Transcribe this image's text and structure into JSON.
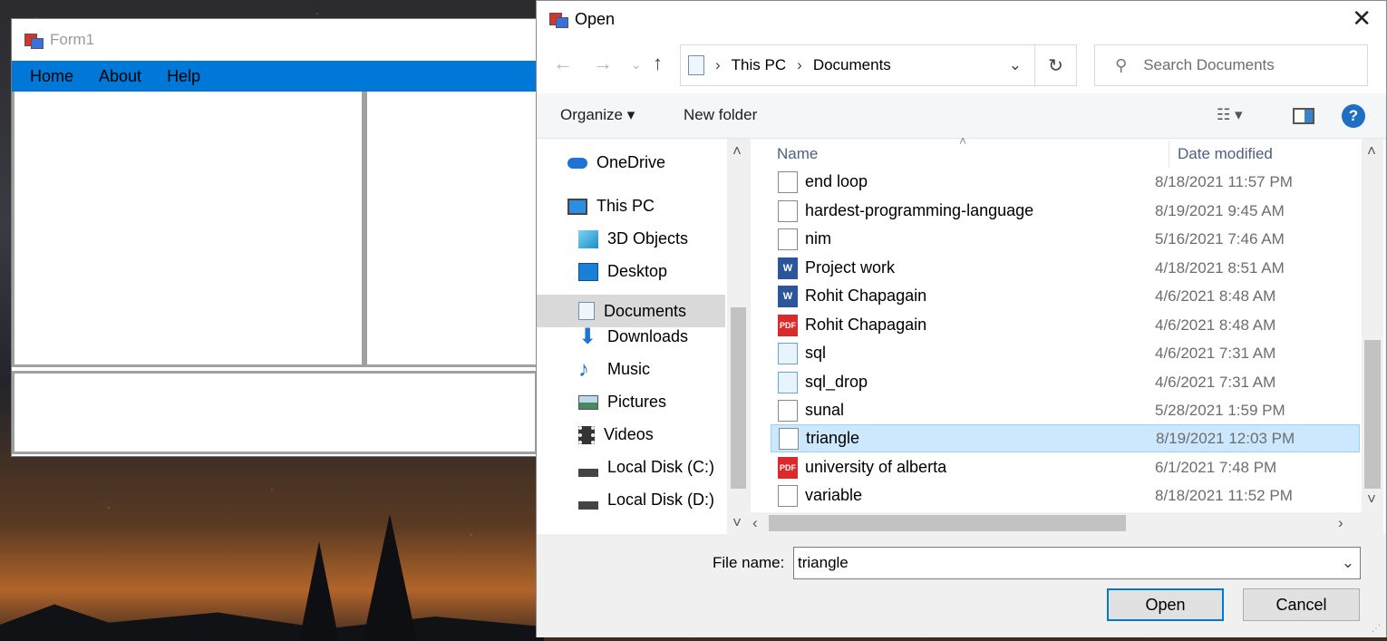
{
  "form1": {
    "title": "Form1",
    "menu": [
      "Home",
      "About",
      "Help"
    ]
  },
  "dialog": {
    "title": "Open",
    "breadcrumb": [
      "This PC",
      "Documents"
    ],
    "search_placeholder": "Search Documents",
    "toolbar": {
      "organize": "Organize",
      "new_folder": "New folder"
    },
    "nav": [
      {
        "label": "OneDrive",
        "icon": "onedrive-icon"
      },
      {
        "label": "This PC",
        "icon": "computer-icon"
      },
      {
        "label": "3D Objects",
        "icon": "3d-objects-icon"
      },
      {
        "label": "Desktop",
        "icon": "desktop-icon"
      },
      {
        "label": "Documents",
        "icon": "documents-icon"
      },
      {
        "label": "Downloads",
        "icon": "downloads-icon"
      },
      {
        "label": "Music",
        "icon": "music-icon"
      },
      {
        "label": "Pictures",
        "icon": "pictures-icon"
      },
      {
        "label": "Videos",
        "icon": "videos-icon"
      },
      {
        "label": "Local Disk (C:)",
        "icon": "drive-icon"
      },
      {
        "label": "Local Disk (D:)",
        "icon": "drive-icon"
      }
    ],
    "columns": {
      "name": "Name",
      "date": "Date modified"
    },
    "files": [
      {
        "name": "end loop",
        "date": "8/18/2021 11:57 PM",
        "type": "txt"
      },
      {
        "name": "hardest-programming-language",
        "date": "8/19/2021 9:45 AM",
        "type": "doc"
      },
      {
        "name": "nim",
        "date": "5/16/2021 7:46 AM",
        "type": "txt"
      },
      {
        "name": "Project work",
        "date": "4/18/2021 8:51 AM",
        "type": "word"
      },
      {
        "name": "Rohit Chapagain",
        "date": "4/6/2021 8:48 AM",
        "type": "word"
      },
      {
        "name": "Rohit Chapagain",
        "date": "4/6/2021 8:48 AM",
        "type": "pdf"
      },
      {
        "name": "sql",
        "date": "4/6/2021 7:31 AM",
        "type": "sql"
      },
      {
        "name": "sql_drop",
        "date": "4/6/2021 7:31 AM",
        "type": "sql"
      },
      {
        "name": "sunal",
        "date": "5/28/2021 1:59 PM",
        "type": "txt"
      },
      {
        "name": "triangle",
        "date": "8/19/2021 12:03 PM",
        "type": "txt",
        "selected": true
      },
      {
        "name": "university of alberta",
        "date": "6/1/2021 7:48 PM",
        "type": "pdf"
      },
      {
        "name": "variable",
        "date": "8/18/2021 11:52 PM",
        "type": "txt"
      }
    ],
    "file_name_label": "File name:",
    "file_name_value": "triangle",
    "open_label": "Open",
    "cancel_label": "Cancel",
    "colors": {
      "menubar": "#0078d7",
      "selection": "#cce8ff",
      "help": "#1e6fc4"
    }
  }
}
